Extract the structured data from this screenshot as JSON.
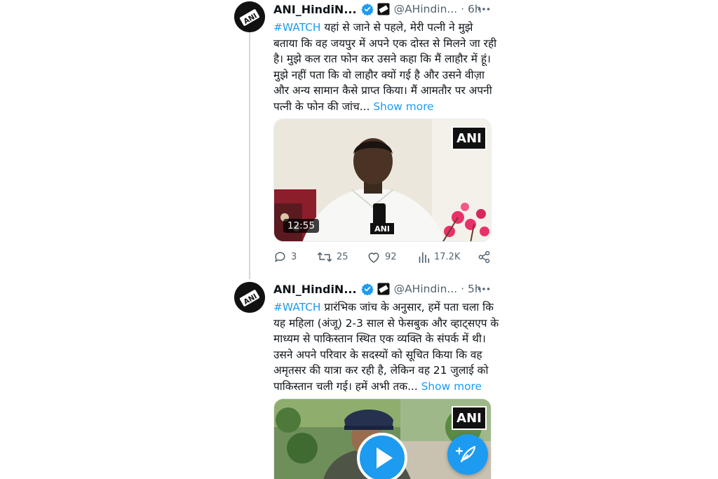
{
  "tweets": [
    {
      "display_name": "ANI_HindiN...",
      "handle": "@AHindin...",
      "separator": "·",
      "time": "6h",
      "hashtag": "#WATCH",
      "lines": [
        " यहां से जाने से पहले, मेरी पत्नी ने मुझे",
        "बताया कि वह जयपुर में अपने एक दोस्त से मिलने जा रही",
        "है। मुझे कल रात फोन कर उसने कहा कि मैं लाहौर में हूं।",
        "मुझे नहीं पता कि वो लाहौर क्यों गई है और उसने वीज़ा",
        "और अन्य सामान कैसे प्राप्त किया। मैं आमतौर पर अपनी",
        "पत्नी के फोन की जांच..."
      ],
      "show_more": "Show more",
      "media": {
        "watermark": "ANI",
        "mic_label": "ANI",
        "duration": "12:55"
      },
      "stats": {
        "replies": "3",
        "retweets": "25",
        "likes": "92",
        "views": "17.2K"
      }
    },
    {
      "display_name": "ANI_HindiN...",
      "handle": "@AHindin...",
      "separator": "·",
      "time": "5h",
      "hashtag": "#WATCH",
      "lines": [
        " प्रारंभिक जांच के अनुसार, हमें पता चला कि",
        "यह महिला (अंजू) 2-3 साल से फेसबुक और व्हाट्सएप के",
        "माध्यम से पाकिस्तान स्थित एक व्यक्ति के संपर्क में थी।",
        "उसने अपने परिवार के सदस्यों को सूचित किया कि वह",
        "अमृतसर की यात्रा कर रही है, लेकिन वह 21 जुलाई को",
        "पाकिस्तान चली गई। हमें अभी तक..."
      ],
      "show_more": "Show more",
      "media": {
        "watermark": "ANI"
      }
    }
  ],
  "colors": {
    "accent": "#1d9bf0",
    "secondary_text": "#536471",
    "thread_line": "#cfd9de"
  },
  "icons": {
    "avatar": "ani-logo",
    "verified": "verified-badge-icon",
    "affiliation": "ani-affiliate-icon",
    "more": "more-dots-icon",
    "reply": "reply-icon",
    "retweet": "retweet-icon",
    "like": "heart-icon",
    "views": "bar-chart-icon",
    "share": "share-icon",
    "play": "play-icon",
    "compose": "compose-feather-icon"
  }
}
